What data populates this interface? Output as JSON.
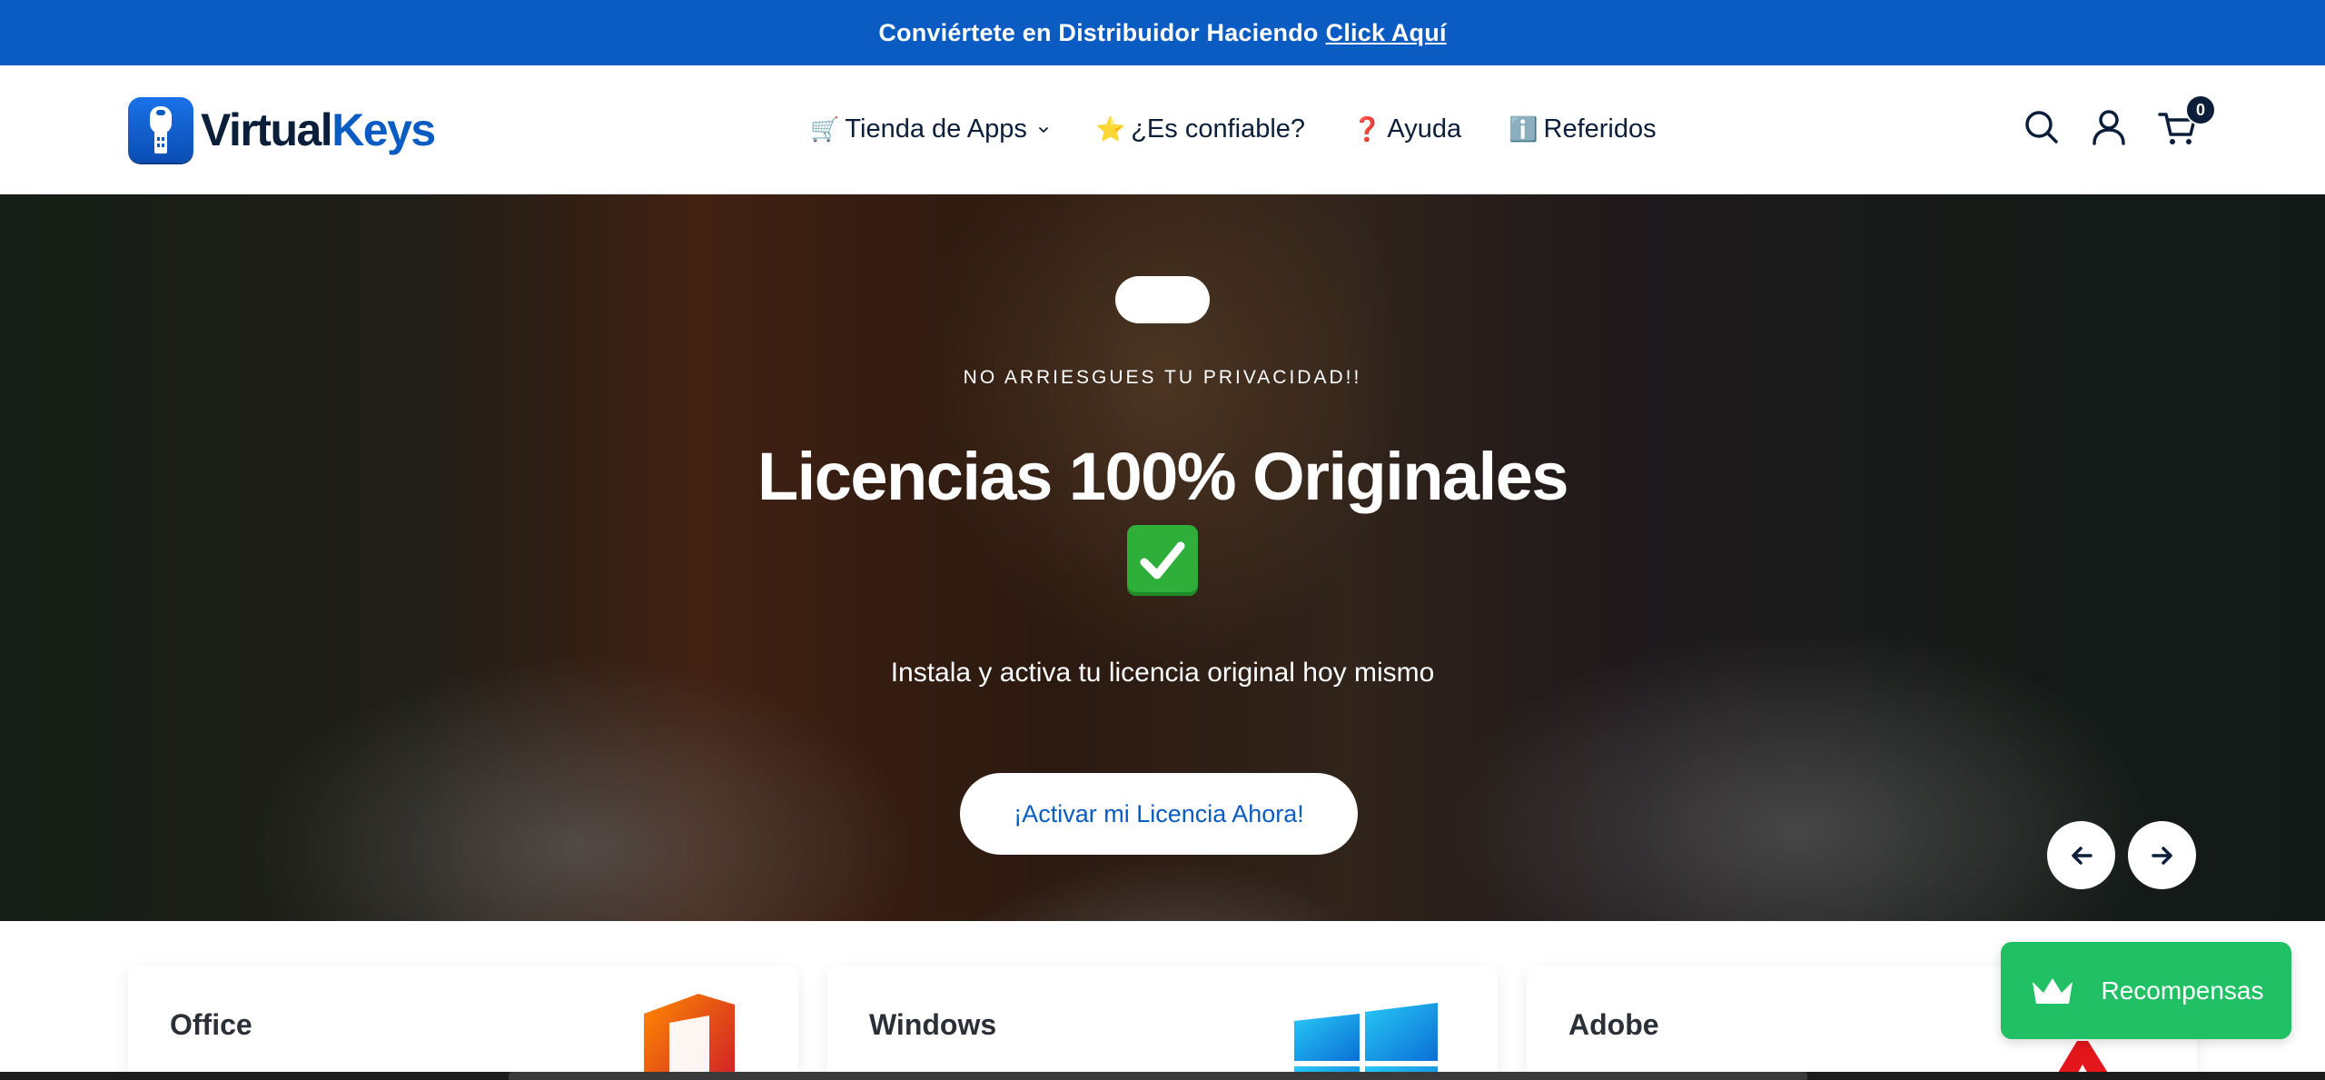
{
  "announcement": {
    "text": "Conviértete en Distribuidor Haciendo",
    "link_label": "Click Aquí"
  },
  "header": {
    "logo": {
      "word1": "Virtual",
      "word2": "Keys"
    },
    "nav": [
      {
        "emoji": "🛒",
        "label": "Tienda de Apps",
        "has_dropdown": true
      },
      {
        "emoji": "⭐",
        "label": "¿Es confiable?"
      },
      {
        "emoji": "❓",
        "label": "Ayuda"
      },
      {
        "emoji": "ℹ️",
        "label": "Referidos"
      }
    ],
    "icons": [
      "search-icon",
      "account-icon",
      "cart-icon"
    ],
    "cart_count": "0"
  },
  "hero": {
    "eyebrow": "NO ARRIESGUES TU PRIVACIDAD!!",
    "title": "Licencias 100% Originales",
    "subtitle": "Instala y activa tu licencia original hoy mismo",
    "cta_label": "¡Activar mi Licencia Ahora!",
    "icons": [
      "arrow-left-icon",
      "arrow-right-icon"
    ]
  },
  "categories": [
    {
      "title": "Office",
      "icon": "office-logo"
    },
    {
      "title": "Windows",
      "icon": "windows-logo"
    },
    {
      "title": "Adobe",
      "icon": "adobe-logo"
    }
  ],
  "rewards": {
    "label": "Recompensas",
    "icon": "crown-icon"
  },
  "colors": {
    "brand_blue": "#0a5bc2",
    "navy": "#0b1f3a",
    "rewards_green": "#21c064"
  }
}
